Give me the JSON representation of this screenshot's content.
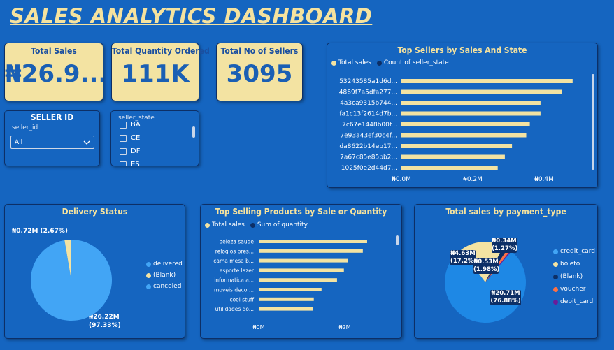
{
  "dashboard": {
    "title": "SALES ANALYTICS DASHBOARD"
  },
  "kpis": [
    {
      "label": "Total Sales",
      "value": "₦26.9..."
    },
    {
      "label": "Total Quantity Ordered",
      "value": "111K"
    },
    {
      "label": "Total No of Sellers",
      "value": "3095"
    }
  ],
  "seller_slicer": {
    "title": "SELLER ID",
    "field": "seller_id",
    "selected": "All",
    "chevron_icon": "chevron-down-icon"
  },
  "state_slicer": {
    "field": "seller_state",
    "items": [
      "BA",
      "CE",
      "DF",
      "ES"
    ]
  },
  "colors": {
    "background": "#1565c0",
    "accent": "#f3e3a2",
    "light_blue": "#42a5f5",
    "navy": "#0d2f66",
    "orange": "#ff7043",
    "purple": "#6a1b9a"
  },
  "charts": {
    "top_sellers": {
      "title": "Top Sellers by Sales And State",
      "legend": [
        "Total sales",
        "Count of seller_state"
      ],
      "ticks": [
        "₦0.0M",
        "₦0.2M",
        "₦0.4M"
      ]
    },
    "delivery": {
      "title": "Delivery Status",
      "legend": [
        "delivered",
        "(Blank)",
        "canceled"
      ],
      "label_small": "₦0.72M (2.67%)",
      "label_big_1": "₦26.22M",
      "label_big_2": "(97.33%)"
    },
    "products": {
      "title": "Top Selling Products by Sale or Quantity",
      "legend": [
        "Total sales",
        "Sum of quantity"
      ],
      "ticks": [
        "₦0M",
        "₦2M"
      ]
    },
    "payment": {
      "title": "Total sales by payment_type",
      "legend": [
        "credit_card",
        "boleto",
        "(Blank)",
        "voucher",
        "debit_card"
      ],
      "labels": [
        {
          "line1": "₦0.34M",
          "line2": "(1.27%)"
        },
        {
          "line1": "₦4.63M",
          "line2": "(17.2%)"
        },
        {
          "line1": "₦0.53M",
          "line2": "(1.98%)"
        },
        {
          "line1": "₦20.71M",
          "line2": "(76.88%)"
        }
      ]
    }
  },
  "chart_data": [
    {
      "type": "bar",
      "title": "Top Sellers by Sales And State",
      "categories": [
        "53243585a1d6d...",
        "4869f7a5dfa277...",
        "4a3ca9315b744...",
        "fa1c13f2614d7b...",
        "7c67e1448b00f...",
        "7e93a43ef30c4f...",
        "da8622b14eb17...",
        "7a67c85e85bb2...",
        "1025f0e2d44d7..."
      ],
      "series": [
        {
          "name": "Total sales",
          "values": [
            0.48,
            0.45,
            0.39,
            0.39,
            0.36,
            0.35,
            0.31,
            0.29,
            0.27
          ]
        }
      ],
      "xlim": [
        0,
        0.55
      ]
    },
    {
      "type": "pie",
      "title": "Delivery Status",
      "categories": [
        "delivered",
        "(Blank)",
        "canceled"
      ],
      "values": [
        26.22,
        0.72,
        0.0
      ]
    },
    {
      "type": "bar",
      "title": "Top Selling Products by Sale or Quantity",
      "categories": [
        "beleza saude",
        "relogios pres...",
        "cama mesa b...",
        "esporte lazer",
        "informatica a...",
        "moveis decor...",
        "cool stuff",
        "utilidades do..."
      ],
      "series": [
        {
          "name": "Total sales",
          "values": [
            1.26,
            1.21,
            1.04,
            0.99,
            0.91,
            0.73,
            0.64,
            0.63
          ]
        }
      ],
      "xlim": [
        0,
        2.4
      ]
    },
    {
      "type": "pie",
      "title": "Total sales by payment_type",
      "categories": [
        "credit_card",
        "boleto",
        "(Blank)",
        "voucher",
        "debit_card"
      ],
      "values": [
        20.71,
        4.63,
        0.53,
        0.34,
        0.12
      ]
    }
  ]
}
